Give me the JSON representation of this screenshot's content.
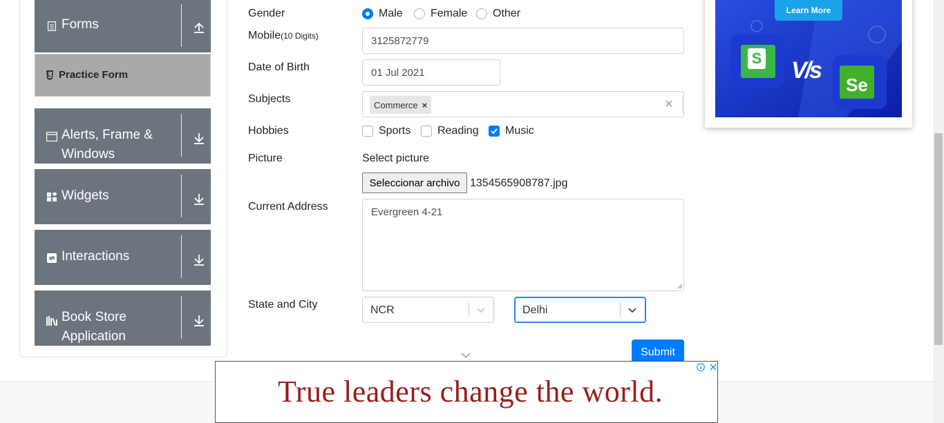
{
  "sidebar": {
    "groups": [
      {
        "label": "Forms",
        "icon": "document-icon"
      },
      {
        "label": "Alerts, Frame & Windows",
        "icon": "window-icon"
      },
      {
        "label": "Widgets",
        "icon": "widgets-icon"
      },
      {
        "label": "Interactions",
        "icon": "interactions-icon"
      },
      {
        "label": "Book Store Application",
        "icon": "books-icon"
      }
    ],
    "active_item": "Practice Form"
  },
  "form": {
    "gender": {
      "label": "Gender",
      "options": [
        "Male",
        "Female",
        "Other"
      ],
      "selected": "Male"
    },
    "mobile": {
      "label": "Mobile",
      "hint": "(10 Digits)",
      "value": "3125872779"
    },
    "dob": {
      "label": "Date of Birth",
      "value": "01 Jul 2021"
    },
    "subjects": {
      "label": "Subjects",
      "chips": [
        "Commerce"
      ],
      "clear_glyph": "×"
    },
    "hobbies": {
      "label": "Hobbies",
      "options": [
        "Sports",
        "Reading",
        "Music"
      ],
      "checked": [
        "Music"
      ]
    },
    "picture": {
      "label": "Picture",
      "prompt": "Select picture",
      "button_label": "Seleccionar archivo",
      "file_name": "1354565908787.jpg"
    },
    "address": {
      "label": "Current Address",
      "value": "Evergreen 4-21"
    },
    "state_city": {
      "label": "State and City",
      "state": "NCR",
      "city": "Delhi"
    },
    "submit_label": "Submit"
  },
  "ads": {
    "right": {
      "button": "Learn More",
      "logo_left": "S",
      "vs_text": "V/s",
      "logo_right": "Se"
    },
    "bottom": {
      "tagline": "True leaders change the world."
    }
  },
  "colors": {
    "sidebar_group": "#6c757d",
    "practice_active": "#a9a9a9",
    "primary": "#007bff",
    "ad_tagline": "#9b1c1c",
    "ad_blue": "#1a3fd6"
  }
}
